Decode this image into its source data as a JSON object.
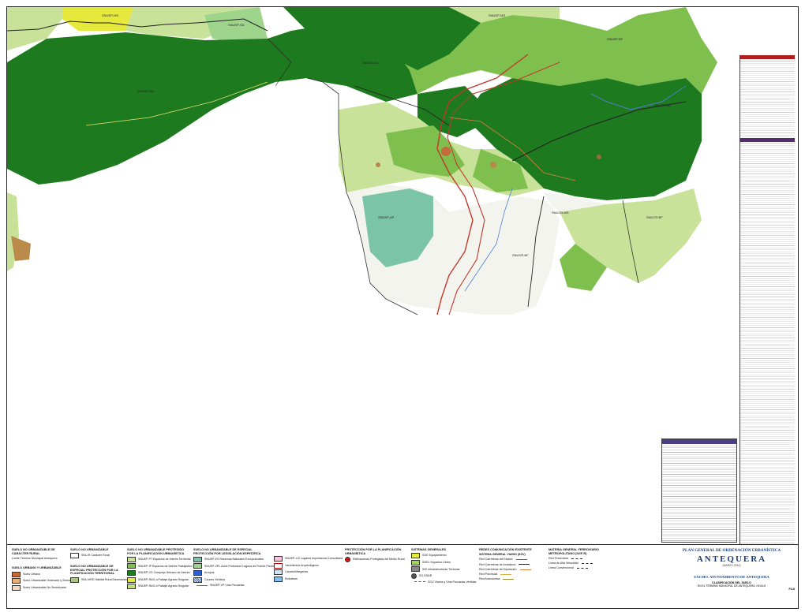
{
  "map": {
    "zone_labels": [
      "SNUEP-MS",
      "SNUEP-SA",
      "SNUEP-MS",
      "SNUEP-BF",
      "SNUEP-SA",
      "SNUEP-MS",
      "SNUEP-SA",
      "SNUEP-AP",
      "SNUCR-MS",
      "SNUCR-BF",
      "SNUCR-BF"
    ],
    "colors": {
      "dark_green": "#1e7a1e",
      "mid_green": "#7fbf4d",
      "light_green": "#c8e29a",
      "pale": "#f4f4ef",
      "blue_green": "#7cc4a8",
      "yellow": "#e6e83c",
      "road_red": "#c0392b",
      "road_dark": "#222222",
      "river": "#4a7fd0"
    }
  },
  "legend": {
    "col1": {
      "head1": "SUELO NO URBANIZABLE DE CARÁCTER RURAL",
      "item1": "Límite Término Municipal Antequera",
      "head2": "SUELO URBANO Y URBANIZABLE",
      "items": [
        "Suelo Urbano",
        "Suelo Urbanizable Ordenado y Sectorizado",
        "Suelo Urbanizable No Sectorizado"
      ]
    },
    "col2": {
      "head1": "SUELO NO URBANIZABLE",
      "item1": "SNU-R Carácter Rural",
      "head2": "SUELO NO URBANIZABLE DE ESPECIAL PROTECCIÓN POR LA PLANIFICACIÓN TERRITORIAL",
      "items": [
        "SNU-HRD Hábitat Rural Diseminado"
      ]
    },
    "col3": {
      "head1": "SUELO NO URBANIZABLE PROTEGIDO POR LA PLANIFICACIÓN URBANÍSTICA",
      "items": [
        "SNUEP-PT Espacios de Interés Territorial",
        "SNUEP-IP Espacios de Interés Paisajístico",
        "SNUEP-CS Complejo Serrano de Interés",
        "SNUEP-RAG-a Paisaje Agrario Singular",
        "SNUEP-RAG-b Paisaje Agrario Singular"
      ]
    },
    "col4": {
      "head1": "SUELO NO URBANIZABLE DE ESPECIAL PROTECCIÓN POR LEGISLACIÓN ESPECÍFICA",
      "items": [
        "SNUEP-ES Reservas Naturales Excepcionales",
        "SNUEP-ZPL Zona Protección Laguna de Fuente Piedra",
        "Arroyos",
        "Cauces Vertidos",
        "SNUEP-VP Vías Pecuarias"
      ]
    },
    "col5": {
      "items": [
        "SNUEP-LIC Lugares Importancia Comunitaria",
        "Yacimientos Arqueológicos",
        "Cauces/Márgenes",
        "Embalses"
      ]
    },
    "col6": {
      "head1": "PROTECCIÓN POR LA PLANIFICACIÓN URBANÍSTICA",
      "items": [
        "Edificaciones Protegidas del Medio Rural"
      ]
    },
    "col7": {
      "head1": "SISTEMAS GENERALES",
      "items": [
        "SGE Equipamiento",
        "SGEL Espacios Libres",
        "SGI Infraestructuras Técnicas",
        "SG EDAR",
        "SGV Viarios y Vías Pecuarias Vertidas"
      ]
    },
    "col8": {
      "head1": "REDES COMUNICACIÓN EXISTENTE",
      "items": [
        "SISTEMA GENERAL VIARIO (SGV)",
        "Red Carreteras del Estado",
        "Red Carreteras de Andalucía",
        "Red Carreteras de Diputación",
        "Red Provincial",
        "Red Autonómica"
      ]
    },
    "col9": {
      "head1": "MATERIA GENERAL FERROVIARIO METROPOLITANO (SGF-R)",
      "items": [
        "Red Ferroviaria",
        "Línea de Alta Velocidad",
        "Línea Convencional"
      ]
    }
  },
  "title_block": {
    "title": "PLAN GENERAL DE ORDENACIÓN URBANÍSTICA",
    "city": "ANTEQUERA",
    "sub": "(MARZO 2010)",
    "ayto": "EXCMO. AYUNTAMIENTO DE ANTEQUERA",
    "plano": "CLASIFICACIÓN DEL SUELO",
    "hoja": "EN EL TÉRMINO MUNICIPAL DE ANTEQUERA. HOJA 8",
    "code": "P.3.8"
  }
}
